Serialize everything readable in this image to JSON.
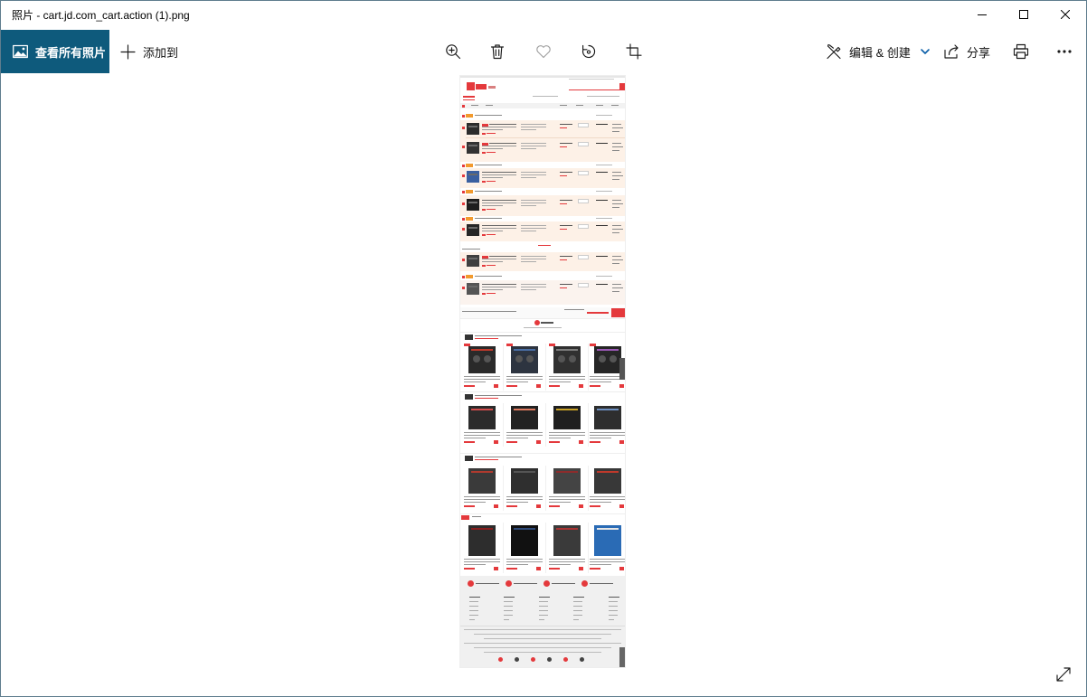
{
  "window": {
    "title": "照片 - cart.jd.com_cart.action (1).png",
    "controls": [
      "minimize-icon",
      "maximize-icon",
      "close-icon"
    ]
  },
  "toolbar": {
    "view_all": {
      "label": "查看所有照片",
      "icon": "photos-icon"
    },
    "add_to": {
      "label": "添加到",
      "icon": "plus-icon"
    },
    "actions": [
      "zoom-in-icon",
      "delete-icon",
      "heart-icon",
      "rotate-icon",
      "crop-icon"
    ],
    "edit_create": {
      "label": "编辑 & 创建",
      "icon": "edit-create-icon",
      "dropdown_icon": "chevron-down-icon"
    },
    "share": {
      "label": "分享",
      "icon": "share-icon"
    },
    "print": {
      "icon": "print-icon"
    },
    "more": {
      "icon": "more-icon"
    }
  },
  "viewer": {
    "fullscreen_icon": "fullscreen-icon"
  },
  "colors": {
    "accent": "#0e5a7c",
    "dropdown_chevron": "#0a5ea8",
    "favorite_disabled": "#a0a0a0",
    "image_brand_red": "#e4393c"
  }
}
